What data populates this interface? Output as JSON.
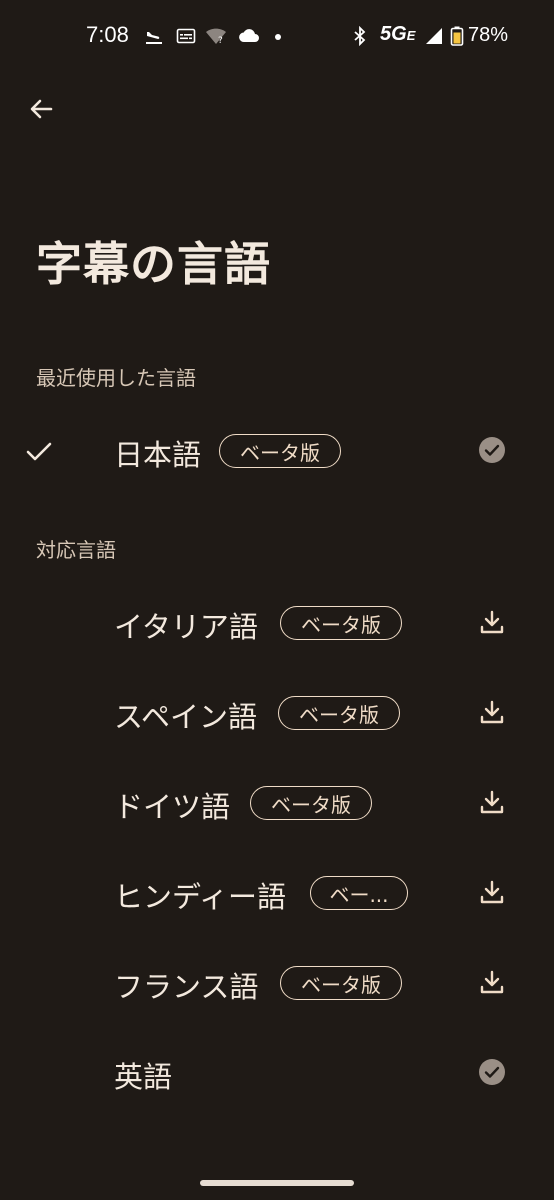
{
  "status_bar": {
    "time": "7:08",
    "network": "5G",
    "network_suffix": "E",
    "battery": "78%",
    "icons": [
      "airplane-landing-icon",
      "subtitles-icon",
      "wifi-unknown-icon",
      "cloud-icon",
      "dot-icon",
      "bluetooth-icon",
      "signal-icon",
      "battery-icon"
    ]
  },
  "header": {
    "back_icon": "arrow-back-icon",
    "title": "字幕の言語"
  },
  "sections": {
    "recent": {
      "label": "最近使用した言語",
      "items": [
        {
          "name": "日本語",
          "badge": "ベータ版",
          "selected": true,
          "status": "downloaded"
        }
      ]
    },
    "supported": {
      "label": "対応言語",
      "items": [
        {
          "name": "イタリア語",
          "badge": "ベータ版",
          "status": "download"
        },
        {
          "name": "スペイン語",
          "badge": "ベータ版",
          "status": "download"
        },
        {
          "name": "ドイツ語",
          "badge": "ベータ版",
          "status": "download"
        },
        {
          "name": "ヒンディー語",
          "badge": "ベー...",
          "status": "download"
        },
        {
          "name": "フランス語",
          "badge": "ベータ版",
          "status": "download"
        },
        {
          "name": "英語",
          "badge": "",
          "status": "downloaded"
        }
      ]
    }
  },
  "colors": {
    "background": "#1f1a16",
    "text": "#f3e9de",
    "badge_border": "#f0dcc7",
    "downloaded_icon": "#9a8f86"
  }
}
